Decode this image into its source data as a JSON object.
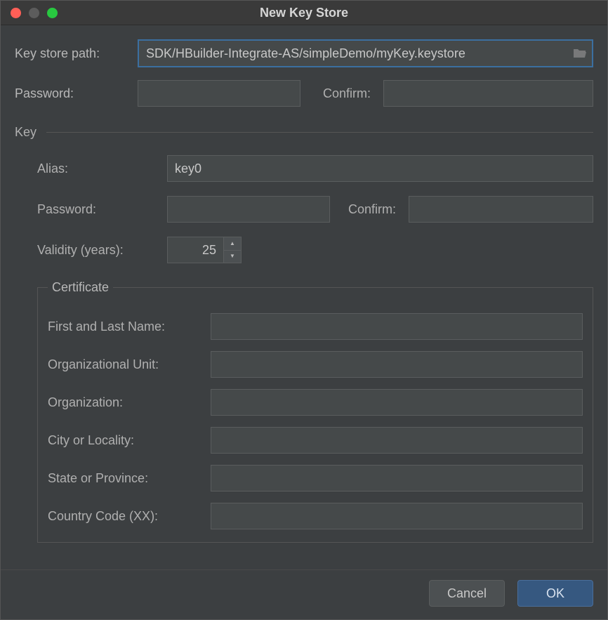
{
  "window": {
    "title": "New Key Store"
  },
  "keystore": {
    "path_label": "Key store path:",
    "path_value": "SDK/HBuilder-Integrate-AS/simpleDemo/myKey.keystore",
    "password_label": "Password:",
    "password_value": "",
    "confirm_label": "Confirm:",
    "confirm_value": ""
  },
  "key_section": {
    "title": "Key",
    "alias_label": "Alias:",
    "alias_value": "key0",
    "password_label": "Password:",
    "password_value": "",
    "confirm_label": "Confirm:",
    "confirm_value": "",
    "validity_label": "Validity (years):",
    "validity_value": "25"
  },
  "certificate": {
    "legend": "Certificate",
    "first_last_label": "First and Last Name:",
    "first_last_value": "",
    "org_unit_label": "Organizational Unit:",
    "org_unit_value": "",
    "organization_label": "Organization:",
    "organization_value": "",
    "city_label": "City or Locality:",
    "city_value": "",
    "state_label": "State or Province:",
    "state_value": "",
    "country_label": "Country Code (XX):",
    "country_value": ""
  },
  "buttons": {
    "cancel": "Cancel",
    "ok": "OK"
  }
}
